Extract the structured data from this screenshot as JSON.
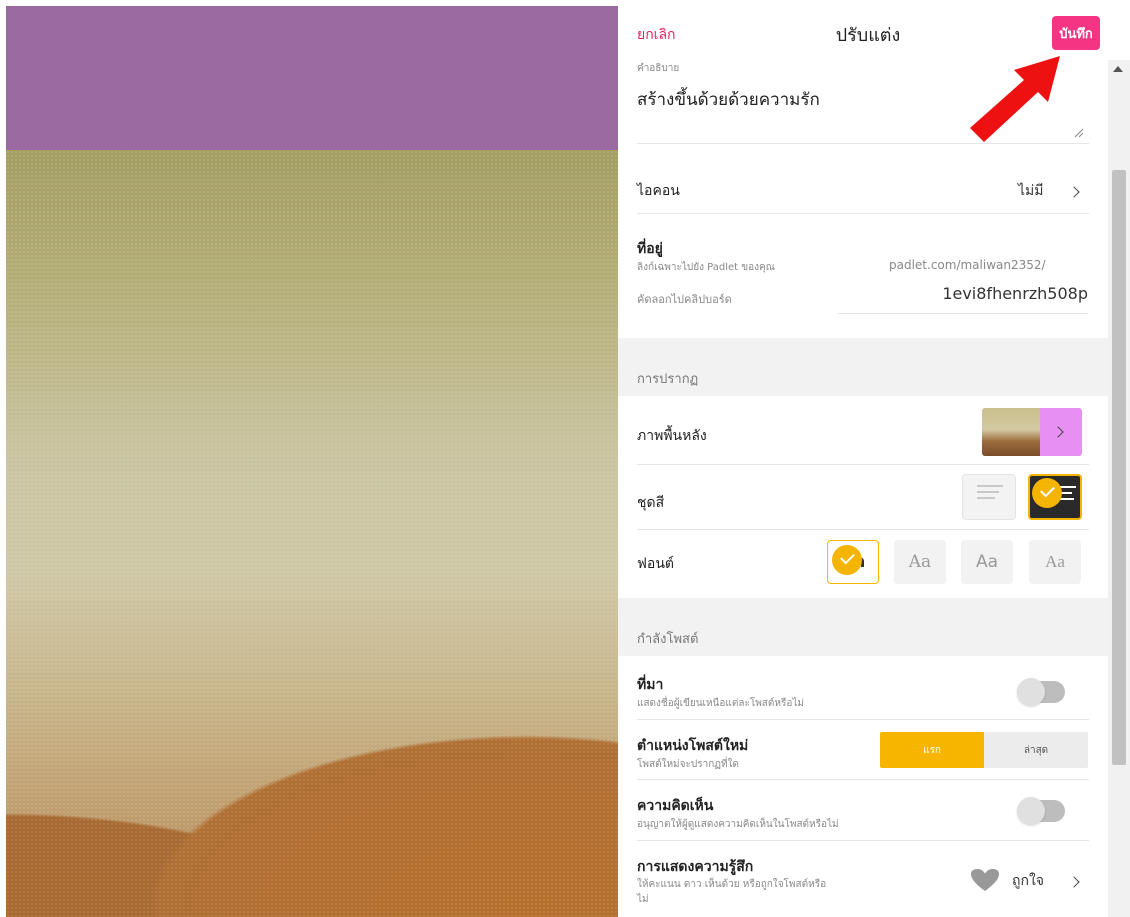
{
  "header": {
    "cancel_label": "ยกเลิก",
    "title": "ปรับแต่ง",
    "save_label": "บันทึก"
  },
  "description": {
    "label": "คำอธิบาย",
    "value": "สร้างขึ้นด้วยด้วยความรัก"
  },
  "icon": {
    "label": "ไอคอน",
    "value": "ไม่มี"
  },
  "address": {
    "label": "ที่อยู่",
    "sublabel": "ลิงก์เฉพาะไปยัง Padlet ของคุณ",
    "domain": "padlet.com/maliwan2352/",
    "copy_label": "คัดลอกไปคลิปบอร์ด",
    "slug": "1evi8fhenrzh508p"
  },
  "appearance": {
    "section_label": "การปรากฏ",
    "background_label": "ภาพพื้นหลัง",
    "color_scheme_label": "ชุดสี",
    "font_label": "ฟอนต์",
    "font_options": [
      "Aa",
      "Aa",
      "Aa",
      "Aa"
    ],
    "selected_font_index": 0,
    "selected_theme": "dark"
  },
  "posting": {
    "section_label": "กำลังโพสต์",
    "attribution_label": "ที่มา",
    "attribution_sub": "แสดงชื่อผู้เขียนเหนือแต่ละโพสต์หรือไม่",
    "attribution_on": false,
    "new_post_label": "ตำแหน่งโพสต์ใหม่",
    "new_post_sub": "โพสต์ใหม่จะปรากฏที่ใด",
    "new_post_options": [
      "แรก",
      "ล่าสุด"
    ],
    "new_post_selected": "แรก",
    "comments_label": "ความคิดเห็น",
    "comments_sub": "อนุญาตให้ผู้ดูแสดงความคิดเห็นในโพสต์หรือไม่",
    "comments_on": false,
    "reactions_label": "การแสดงความรู้สึก",
    "reactions_sub_1": "ให้คะแนน ดาว เห็นด้วย หรือถูกใจโพสต์หรือ",
    "reactions_sub_2": "ไม่",
    "reactions_value": "ถูกใจ"
  },
  "colors": {
    "accent": "#f53583",
    "cancel": "#e0245e",
    "selection": "#f5b400",
    "background_top": "#9a6aa0",
    "thumb_button": "#e78ff2"
  }
}
